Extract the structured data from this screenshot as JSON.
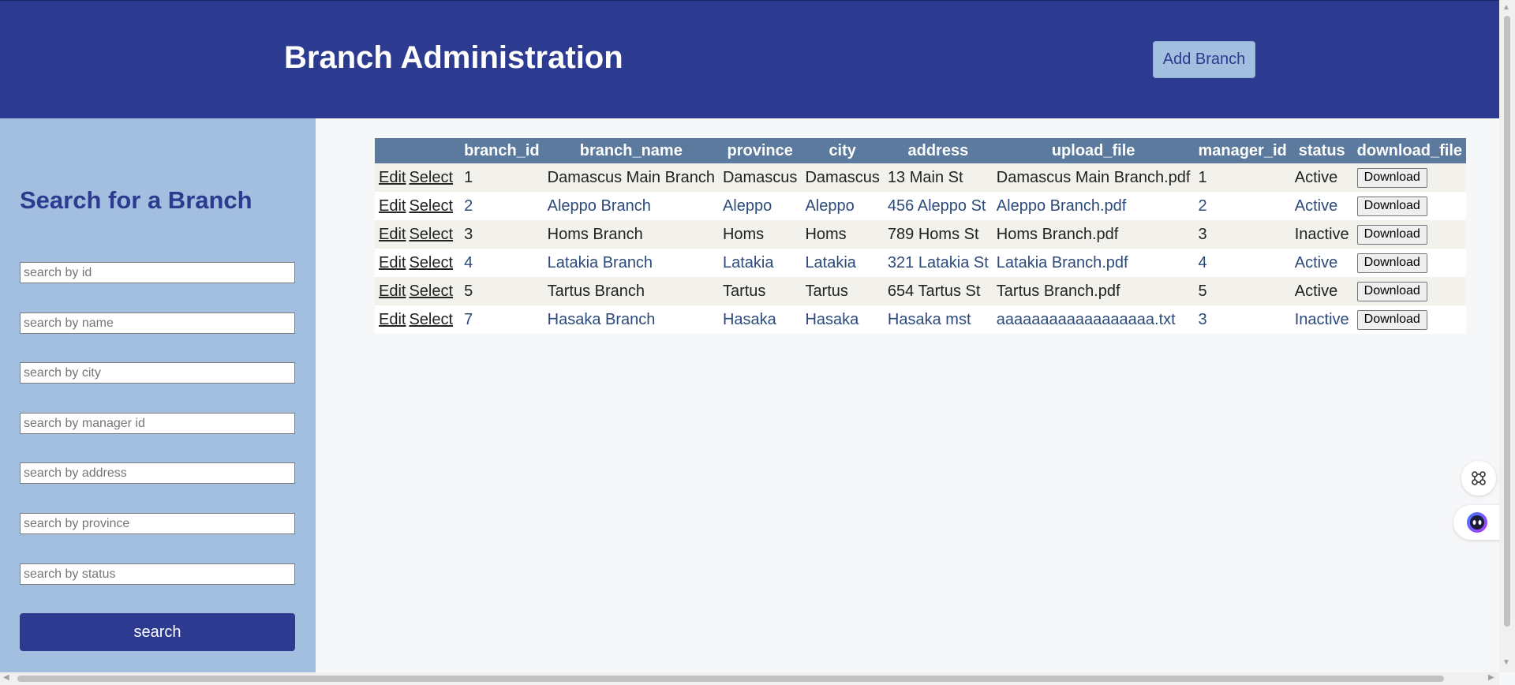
{
  "header": {
    "title": "Branch Administration",
    "add_button": "Add Branch"
  },
  "sidebar": {
    "title": "Search for a Branch",
    "placeholders": [
      "search by id",
      "search by name",
      "search by city",
      "search by manager id",
      "search by address",
      "search by province",
      "search by status"
    ],
    "search_button": "search"
  },
  "table": {
    "columns": [
      "",
      "branch_id",
      "branch_name",
      "province",
      "city",
      "address",
      "upload_file",
      "manager_id",
      "status",
      "download_file"
    ],
    "edit_label": "Edit",
    "select_label": "Select",
    "download_label": "Download",
    "rows": [
      [
        "1",
        "Damascus Main Branch",
        "Damascus",
        "Damascus",
        "13 Main St",
        "Damascus Main Branch.pdf",
        "1",
        "Active"
      ],
      [
        "2",
        "Aleppo Branch",
        "Aleppo",
        "Aleppo",
        "456 Aleppo St",
        "Aleppo Branch.pdf",
        "2",
        "Active"
      ],
      [
        "3",
        "Homs Branch",
        "Homs",
        "Homs",
        "789 Homs St",
        "Homs Branch.pdf",
        "3",
        "Inactive"
      ],
      [
        "4",
        "Latakia Branch",
        "Latakia",
        "Latakia",
        "321 Latakia St",
        "Latakia Branch.pdf",
        "4",
        "Active"
      ],
      [
        "5",
        "Tartus Branch",
        "Tartus",
        "Tartus",
        "654 Tartus St",
        "Tartus Branch.pdf",
        "5",
        "Active"
      ],
      [
        "7",
        "Hasaka Branch",
        "Hasaka",
        "Hasaka",
        "Hasaka mst",
        "aaaaaaaaaaaaaaaaaa.txt",
        "3",
        "Inactive"
      ]
    ]
  },
  "colors": {
    "header_bg": "#2c3a8f",
    "sidebar_bg": "#a3bfe0",
    "table_header_bg": "#5b7a9e",
    "row_odd_bg": "#f2f1ec",
    "row_even_bg": "#ffffff"
  },
  "icons": {
    "float_top": "command-icon",
    "float_bottom": "assistant-face-icon"
  }
}
